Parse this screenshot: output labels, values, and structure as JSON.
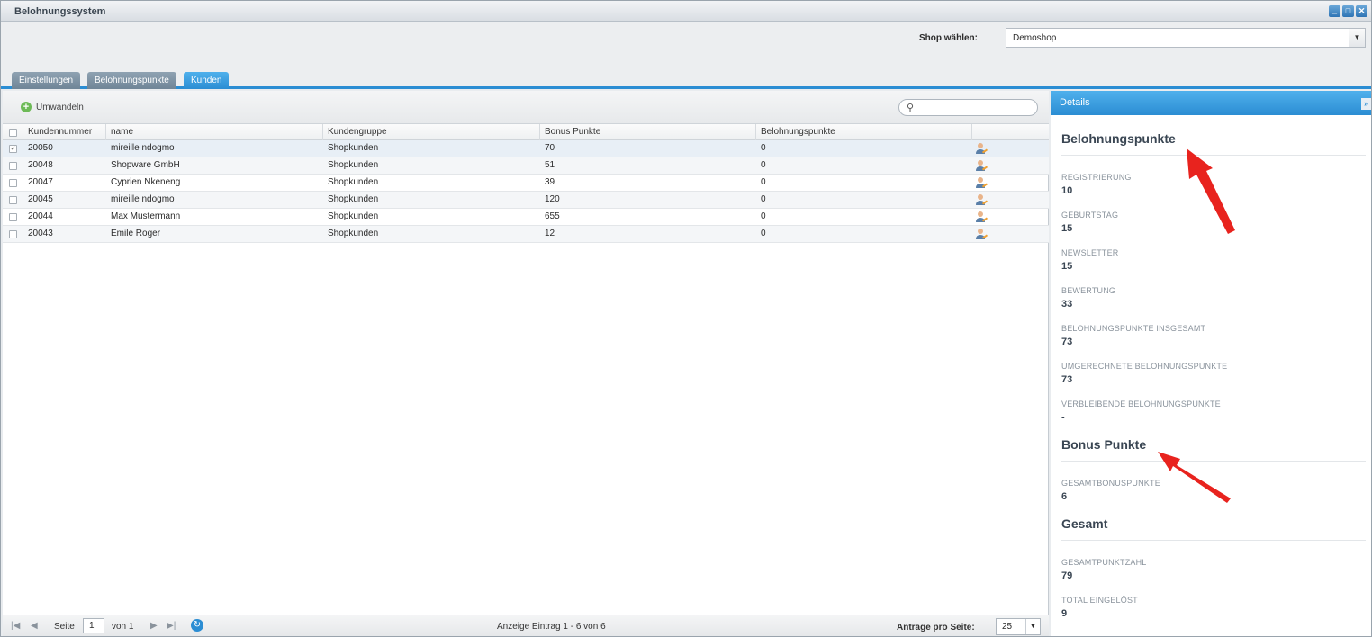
{
  "window": {
    "title": "Belohnungssystem"
  },
  "shop": {
    "label": "Shop wählen:",
    "selected": "Demoshop"
  },
  "tabs": [
    {
      "label": "Einstellungen"
    },
    {
      "label": "Belohnungspunkte"
    },
    {
      "label": "Kunden"
    }
  ],
  "toolbar": {
    "convert_label": "Umwandeln",
    "search_placeholder": ""
  },
  "grid": {
    "columns": [
      "Kundennummer",
      "name",
      "Kundengruppe",
      "Bonus Punkte",
      "Belohnungspunkte"
    ],
    "rows": [
      {
        "id": "20050",
        "name": "mireille ndogmo",
        "group": "Shopkunden",
        "bonus": "70",
        "reward": "0",
        "checked": "✓"
      },
      {
        "id": "20048",
        "name": "Shopware GmbH",
        "group": "Shopkunden",
        "bonus": "51",
        "reward": "0",
        "checked": ""
      },
      {
        "id": "20047",
        "name": "Cyprien Nkeneng",
        "group": "Shopkunden",
        "bonus": "39",
        "reward": "0",
        "checked": ""
      },
      {
        "id": "20045",
        "name": "mireille ndogmo",
        "group": "Shopkunden",
        "bonus": "120",
        "reward": "0",
        "checked": ""
      },
      {
        "id": "20044",
        "name": "Max Mustermann",
        "group": "Shopkunden",
        "bonus": "655",
        "reward": "0",
        "checked": ""
      },
      {
        "id": "20043",
        "name": "Emile Roger",
        "group": "Shopkunden",
        "bonus": "12",
        "reward": "0",
        "checked": ""
      }
    ]
  },
  "pager": {
    "page_label": "Seite",
    "page_value": "1",
    "of_label": "von 1",
    "display_info": "Anzeige Eintrag 1 - 6 von 6",
    "per_page_label": "Anträge pro Seite:",
    "per_page_value": "25"
  },
  "details": {
    "title": "Details",
    "sections": [
      {
        "heading": "Belohnungspunkte",
        "fields": [
          {
            "label": "REGISTRIERUNG",
            "value": "10"
          },
          {
            "label": "GEBURTSTAG",
            "value": "15"
          },
          {
            "label": "NEWSLETTER",
            "value": "15"
          },
          {
            "label": "BEWERTUNG",
            "value": "33"
          },
          {
            "label": "BELOHNUNGSPUNKTE INSGESAMT",
            "value": "73"
          },
          {
            "label": "UMGERECHNETE BELOHNUNGSPUNKTE",
            "value": "73"
          },
          {
            "label": "VERBLEIBENDE BELOHNUNGSPUNKTE",
            "value": "-"
          }
        ]
      },
      {
        "heading": "Bonus Punkte",
        "fields": [
          {
            "label": "GESAMTBONUSPUNKTE",
            "value": "6"
          }
        ]
      },
      {
        "heading": "Gesamt",
        "fields": [
          {
            "label": "GESAMTPUNKTZAHL",
            "value": "79"
          },
          {
            "label": "TOTAL EINGELÖST",
            "value": "9"
          }
        ]
      }
    ]
  },
  "colors": {
    "accent": "#2b8dd3",
    "annotation_arrow": "#e8231e"
  },
  "icons": {
    "user_edit": "user-edit-icon",
    "search": "search-icon",
    "refresh": "refresh-icon"
  }
}
